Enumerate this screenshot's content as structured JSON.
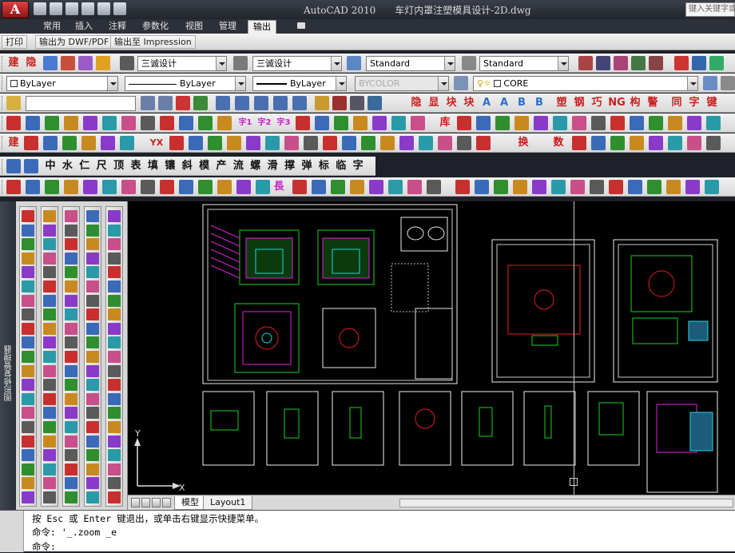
{
  "app": {
    "title": "AutoCAD 2010　　车灯内罩注塑模具设计-2D.dwg",
    "search_placeholder": "键入关键字或短语"
  },
  "ribbon_tabs": [
    "常用",
    "插入",
    "注释",
    "参数化",
    "视图",
    "管理",
    "输出"
  ],
  "active_tab": "输出",
  "ribbon_buttons": [
    "打印",
    "输出为 DWF/PDF",
    "输出至 Impression"
  ],
  "toolbar1": {
    "textstyle": "三诚设计",
    "dimstyle": "三诚设计",
    "tablestyle": "Standard",
    "mleaderstyle": "Standard",
    "labels": [
      "建",
      "隐"
    ]
  },
  "toolbar2": {
    "color": "ByLayer",
    "linetype": "ByLayer",
    "lineweight": "ByLayer",
    "plotstyle": "BYCOLOR",
    "layer": "CORE"
  },
  "toolbar3": {
    "chars": [
      "隐",
      "显",
      "块",
      "块",
      "A",
      "A",
      "B",
      "B",
      "塑",
      "钢",
      "巧",
      "NG",
      "构",
      "警",
      "同",
      "字",
      "键"
    ]
  },
  "toolbar4": {
    "chars": [
      "字1",
      "字2",
      "字3",
      "库"
    ]
  },
  "toolbar5": {
    "chars": [
      "建",
      "YX",
      "换",
      "数"
    ]
  },
  "toolbar6": {
    "chars": [
      "中",
      "水",
      "仁",
      "尺",
      "顶",
      "表",
      "填",
      "镶",
      "斜",
      "模",
      "产",
      "流",
      "螺",
      "滑",
      "撑",
      "弹",
      "标",
      "临",
      "字"
    ]
  },
  "toolbar7": {
    "chars": [
      "長"
    ]
  },
  "palette": {
    "title": "图形修复管理器"
  },
  "canvas": {
    "ucs_x": "X",
    "ucs_y": "Y"
  },
  "layout_tabs": [
    "模型",
    "Layout1"
  ],
  "active_layout": "模型",
  "command": {
    "line1": "按 Esc 或 Enter 键退出，或单击右键显示快捷菜单。",
    "line2": "命令: '_.zoom _e",
    "line3": "命令:"
  },
  "colors": {
    "canvas_bg": "#000000",
    "titlebar": "#2a2e36",
    "accent_red": "#c81e1e",
    "drawing_green": "#19d219",
    "drawing_magenta": "#e01ee0",
    "drawing_cyan": "#22d4e0",
    "drawing_red": "#e02020"
  }
}
